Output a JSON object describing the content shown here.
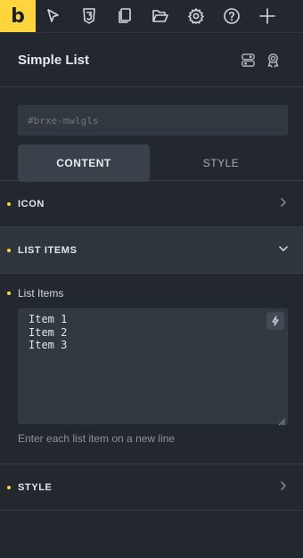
{
  "toolbar": {
    "logo": "b",
    "tools": [
      {
        "name": "select-element-icon"
      },
      {
        "name": "css3-icon"
      },
      {
        "name": "pages-icon"
      },
      {
        "name": "folder-icon"
      },
      {
        "name": "settings-gear-icon"
      },
      {
        "name": "help-icon"
      },
      {
        "name": "add-plus-icon"
      }
    ]
  },
  "header": {
    "title": "Simple List",
    "icons": [
      "toggle-layout-icon",
      "badge-icon"
    ]
  },
  "element": {
    "id_placeholder": "#brxe-mwlgls",
    "tabs": {
      "content": "CONTENT",
      "style": "STYLE"
    }
  },
  "groups": {
    "icon": "ICON",
    "list_items": "LIST ITEMS",
    "style": "STYLE"
  },
  "list_items_control": {
    "label": "List Items",
    "value": "Item 1\nItem 2\nItem 3",
    "hint": "Enter each list item on a new line"
  },
  "colors": {
    "accent": "#ffd53e",
    "panel_bg": "#23272e",
    "open_group_bg": "#2f353d"
  }
}
